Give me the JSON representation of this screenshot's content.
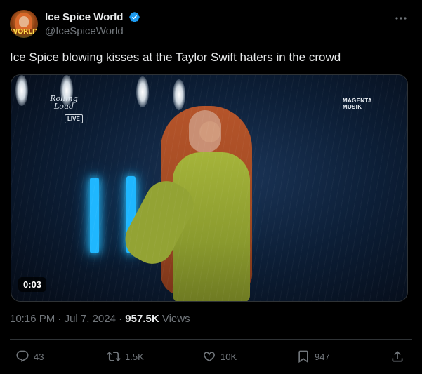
{
  "account": {
    "display_name": "Ice Spice World",
    "handle": "@IceSpiceWorld",
    "avatar_text": "WORLD",
    "verified": true
  },
  "tweet": {
    "text": "Ice Spice blowing kisses at the Taylor Swift haters in the crowd",
    "media": {
      "duration": "0:03",
      "overlay_logo": "Rolling Loud",
      "live_badge": "LIVE",
      "broadcaster_line1": "MAGENTA",
      "broadcaster_line2": "MUSIK"
    },
    "time": "10:16 PM",
    "separator": "·",
    "date": "Jul 7, 2024",
    "views_count": "957.5K",
    "views_label": "Views"
  },
  "actions": {
    "replies": "43",
    "reposts": "1.5K",
    "likes": "10K",
    "bookmarks": "947"
  },
  "icons": {
    "more": "more-icon",
    "verified": "verified-badge-icon",
    "reply": "reply-icon",
    "repost": "repost-icon",
    "like": "heart-icon",
    "bookmark": "bookmark-icon",
    "share": "share-icon"
  },
  "colors": {
    "background": "#000000",
    "text_primary": "#e7e9ea",
    "text_secondary": "#71767b",
    "verified_blue": "#1d9bf0",
    "divider": "#2f3336"
  }
}
